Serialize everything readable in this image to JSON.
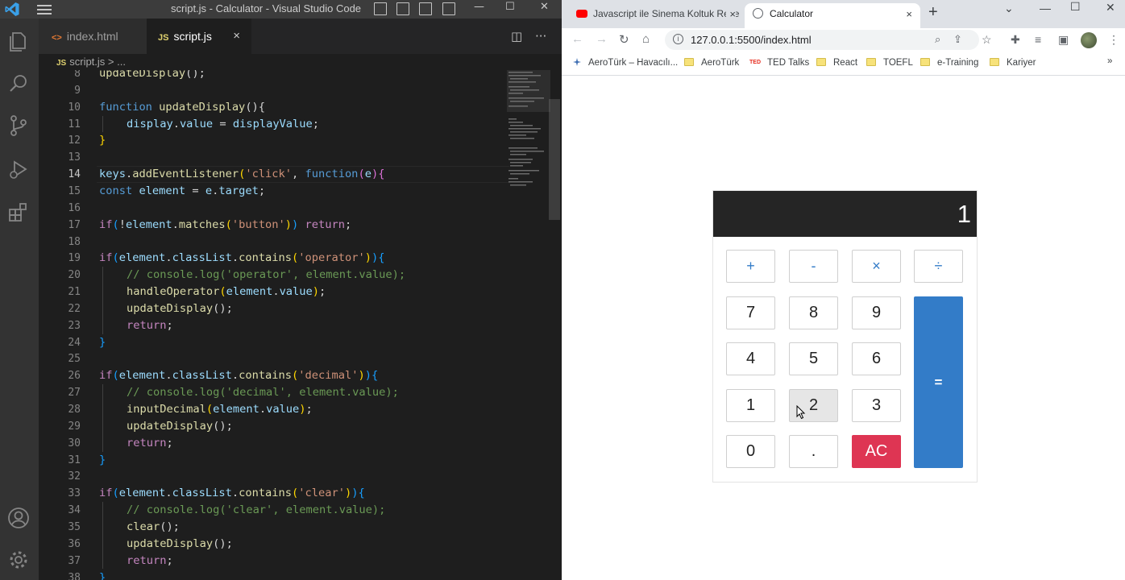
{
  "vscode": {
    "window_title": "script.js - Calculator - Visual Studio Code",
    "tabs": [
      {
        "icon_text": "<>",
        "label": "index.html"
      },
      {
        "icon_text": "JS",
        "label": "script.js",
        "close": "×"
      }
    ],
    "breadcrumb": {
      "icon_text": "JS",
      "file": "script.js",
      "sep": " > ",
      "rest": "..."
    },
    "current_line": 14,
    "code_lines": [
      {
        "n": 8,
        "tokens": [
          {
            "t": "updateDisplay",
            "c": "fn"
          },
          {
            "t": "();"
          }
        ]
      },
      {
        "n": 9,
        "tokens": []
      },
      {
        "n": 10,
        "tokens": [
          {
            "t": "function ",
            "c": "kw"
          },
          {
            "t": "updateDisplay",
            "c": "fn"
          },
          {
            "t": "(){"
          }
        ]
      },
      {
        "n": 11,
        "indent": 1,
        "tokens": [
          {
            "t": "display",
            "c": "var"
          },
          {
            "t": "."
          },
          {
            "t": "value",
            "c": "var"
          },
          {
            "t": " = "
          },
          {
            "t": "displayValue",
            "c": "var"
          },
          {
            "t": ";"
          }
        ]
      },
      {
        "n": 12,
        "tokens": [
          {
            "t": "}",
            "c": "p1"
          }
        ]
      },
      {
        "n": 13,
        "tokens": []
      },
      {
        "n": 14,
        "tokens": [
          {
            "t": "keys",
            "c": "var"
          },
          {
            "t": "."
          },
          {
            "t": "addEventListener",
            "c": "fn"
          },
          {
            "t": "(",
            "c": "p1"
          },
          {
            "t": "'click'",
            "c": "str"
          },
          {
            "t": ", "
          },
          {
            "t": "function",
            "c": "kw"
          },
          {
            "t": "(",
            "c": "p2"
          },
          {
            "t": "e",
            "c": "var"
          },
          {
            "t": ")",
            "c": "p2"
          },
          {
            "t": "{",
            "c": "p2"
          }
        ]
      },
      {
        "n": 15,
        "tokens": [
          {
            "t": "const ",
            "c": "kw"
          },
          {
            "t": "element",
            "c": "var"
          },
          {
            "t": " = "
          },
          {
            "t": "e",
            "c": "var"
          },
          {
            "t": "."
          },
          {
            "t": "target",
            "c": "var"
          },
          {
            "t": ";"
          }
        ]
      },
      {
        "n": 16,
        "tokens": []
      },
      {
        "n": 17,
        "tokens": [
          {
            "t": "if",
            "c": "ct"
          },
          {
            "t": "(",
            "c": "p3"
          },
          {
            "t": "!"
          },
          {
            "t": "element",
            "c": "var"
          },
          {
            "t": "."
          },
          {
            "t": "matches",
            "c": "fn"
          },
          {
            "t": "(",
            "c": "p1"
          },
          {
            "t": "'button'",
            "c": "str"
          },
          {
            "t": ")",
            "c": "p1"
          },
          {
            "t": ")",
            "c": "p3"
          },
          {
            "t": " "
          },
          {
            "t": "return",
            "c": "ct"
          },
          {
            "t": ";"
          }
        ]
      },
      {
        "n": 18,
        "tokens": []
      },
      {
        "n": 19,
        "tokens": [
          {
            "t": "if",
            "c": "ct"
          },
          {
            "t": "(",
            "c": "p3"
          },
          {
            "t": "element",
            "c": "var"
          },
          {
            "t": "."
          },
          {
            "t": "classList",
            "c": "var"
          },
          {
            "t": "."
          },
          {
            "t": "contains",
            "c": "fn"
          },
          {
            "t": "(",
            "c": "p1"
          },
          {
            "t": "'operator'",
            "c": "str"
          },
          {
            "t": ")",
            "c": "p1"
          },
          {
            "t": ")",
            "c": "p3"
          },
          {
            "t": "{",
            "c": "p3"
          }
        ]
      },
      {
        "n": 20,
        "indent": 1,
        "tokens": [
          {
            "t": "// console.log('operator', element.value);",
            "c": "cm"
          }
        ]
      },
      {
        "n": 21,
        "indent": 1,
        "tokens": [
          {
            "t": "handleOperator",
            "c": "fn"
          },
          {
            "t": "(",
            "c": "p1"
          },
          {
            "t": "element",
            "c": "var"
          },
          {
            "t": "."
          },
          {
            "t": "value",
            "c": "var"
          },
          {
            "t": ")",
            "c": "p1"
          },
          {
            "t": ";"
          }
        ]
      },
      {
        "n": 22,
        "indent": 1,
        "tokens": [
          {
            "t": "updateDisplay",
            "c": "fn"
          },
          {
            "t": "();"
          }
        ]
      },
      {
        "n": 23,
        "indent": 1,
        "tokens": [
          {
            "t": "return",
            "c": "ct"
          },
          {
            "t": ";"
          }
        ]
      },
      {
        "n": 24,
        "tokens": [
          {
            "t": "}",
            "c": "p3"
          }
        ]
      },
      {
        "n": 25,
        "tokens": []
      },
      {
        "n": 26,
        "tokens": [
          {
            "t": "if",
            "c": "ct"
          },
          {
            "t": "(",
            "c": "p3"
          },
          {
            "t": "element",
            "c": "var"
          },
          {
            "t": "."
          },
          {
            "t": "classList",
            "c": "var"
          },
          {
            "t": "."
          },
          {
            "t": "contains",
            "c": "fn"
          },
          {
            "t": "(",
            "c": "p1"
          },
          {
            "t": "'decimal'",
            "c": "str"
          },
          {
            "t": ")",
            "c": "p1"
          },
          {
            "t": ")",
            "c": "p3"
          },
          {
            "t": "{",
            "c": "p3"
          }
        ]
      },
      {
        "n": 27,
        "indent": 1,
        "tokens": [
          {
            "t": "// console.log('decimal', element.value);",
            "c": "cm"
          }
        ]
      },
      {
        "n": 28,
        "indent": 1,
        "tokens": [
          {
            "t": "inputDecimal",
            "c": "fn"
          },
          {
            "t": "(",
            "c": "p1"
          },
          {
            "t": "element",
            "c": "var"
          },
          {
            "t": "."
          },
          {
            "t": "value",
            "c": "var"
          },
          {
            "t": ")",
            "c": "p1"
          },
          {
            "t": ";"
          }
        ]
      },
      {
        "n": 29,
        "indent": 1,
        "tokens": [
          {
            "t": "updateDisplay",
            "c": "fn"
          },
          {
            "t": "();"
          }
        ]
      },
      {
        "n": 30,
        "indent": 1,
        "tokens": [
          {
            "t": "return",
            "c": "ct"
          },
          {
            "t": ";"
          }
        ]
      },
      {
        "n": 31,
        "tokens": [
          {
            "t": "}",
            "c": "p3"
          }
        ]
      },
      {
        "n": 32,
        "tokens": []
      },
      {
        "n": 33,
        "tokens": [
          {
            "t": "if",
            "c": "ct"
          },
          {
            "t": "(",
            "c": "p3"
          },
          {
            "t": "element",
            "c": "var"
          },
          {
            "t": "."
          },
          {
            "t": "classList",
            "c": "var"
          },
          {
            "t": "."
          },
          {
            "t": "contains",
            "c": "fn"
          },
          {
            "t": "(",
            "c": "p1"
          },
          {
            "t": "'clear'",
            "c": "str"
          },
          {
            "t": ")",
            "c": "p1"
          },
          {
            "t": ")",
            "c": "p3"
          },
          {
            "t": "{",
            "c": "p3"
          }
        ]
      },
      {
        "n": 34,
        "indent": 1,
        "tokens": [
          {
            "t": "// console.log('clear', element.value);",
            "c": "cm"
          }
        ]
      },
      {
        "n": 35,
        "indent": 1,
        "tokens": [
          {
            "t": "clear",
            "c": "fn"
          },
          {
            "t": "();"
          }
        ]
      },
      {
        "n": 36,
        "indent": 1,
        "tokens": [
          {
            "t": "updateDisplay",
            "c": "fn"
          },
          {
            "t": "();"
          }
        ]
      },
      {
        "n": 37,
        "indent": 1,
        "tokens": [
          {
            "t": "return",
            "c": "ct"
          },
          {
            "t": ";"
          }
        ]
      },
      {
        "n": 38,
        "tokens": [
          {
            "t": "}",
            "c": "p3"
          }
        ]
      }
    ],
    "colors": {
      "background": "#1e1e1e",
      "activity_bar": "#333333",
      "titlebar": "#3c3c3c",
      "keyword": "#569cd6",
      "function": "#dcdcaa",
      "variable": "#9cdcfe",
      "string": "#ce9178",
      "comment": "#6a9955",
      "control": "#c586c0"
    },
    "activity_icons": [
      "explorer-icon",
      "search-icon",
      "source-control-icon",
      "run-debug-icon",
      "extensions-icon",
      "accounts-icon",
      "manage-gear-icon"
    ]
  },
  "chrome": {
    "tabs": [
      {
        "label": "Javascript ile Sinema Koltuk Reze",
        "icon": "youtube-icon",
        "close": "×"
      },
      {
        "label": "Calculator",
        "icon": "globe-icon",
        "close": "×",
        "active": true
      }
    ],
    "new_tab": "+",
    "window_controls": [
      "⌄",
      "—",
      "☐",
      "✕"
    ],
    "url": "127.0.0.1:5500/index.html",
    "bookmarks": [
      {
        "label": "AeroTürk – Havacılı...",
        "icon": "aeroturk-icon"
      },
      {
        "label": "AeroTürk",
        "icon": "folder-icon"
      },
      {
        "label": "TED Talks",
        "icon": "ted-icon"
      },
      {
        "label": "React",
        "icon": "folder-icon"
      },
      {
        "label": "TOEFL",
        "icon": "folder-icon"
      },
      {
        "label": "e-Training",
        "icon": "folder-icon"
      },
      {
        "label": "Kariyer",
        "icon": "folder-icon"
      }
    ],
    "bookmarks_more": "»",
    "calculator": {
      "display_value": "1",
      "operator_keys": [
        "+",
        "-",
        "×",
        "÷"
      ],
      "digit_rows": [
        [
          "7",
          "8",
          "9"
        ],
        [
          "4",
          "5",
          "6"
        ],
        [
          "1",
          "2",
          "3"
        ]
      ],
      "zero": "0",
      "decimal": ".",
      "clear": "AC",
      "equals": "=",
      "hovered_key": "2",
      "colors": {
        "screen": "#252525",
        "operator_text": "#337cc8",
        "clear_bg": "#de3553",
        "equals_bg": "#337cc8"
      }
    }
  }
}
